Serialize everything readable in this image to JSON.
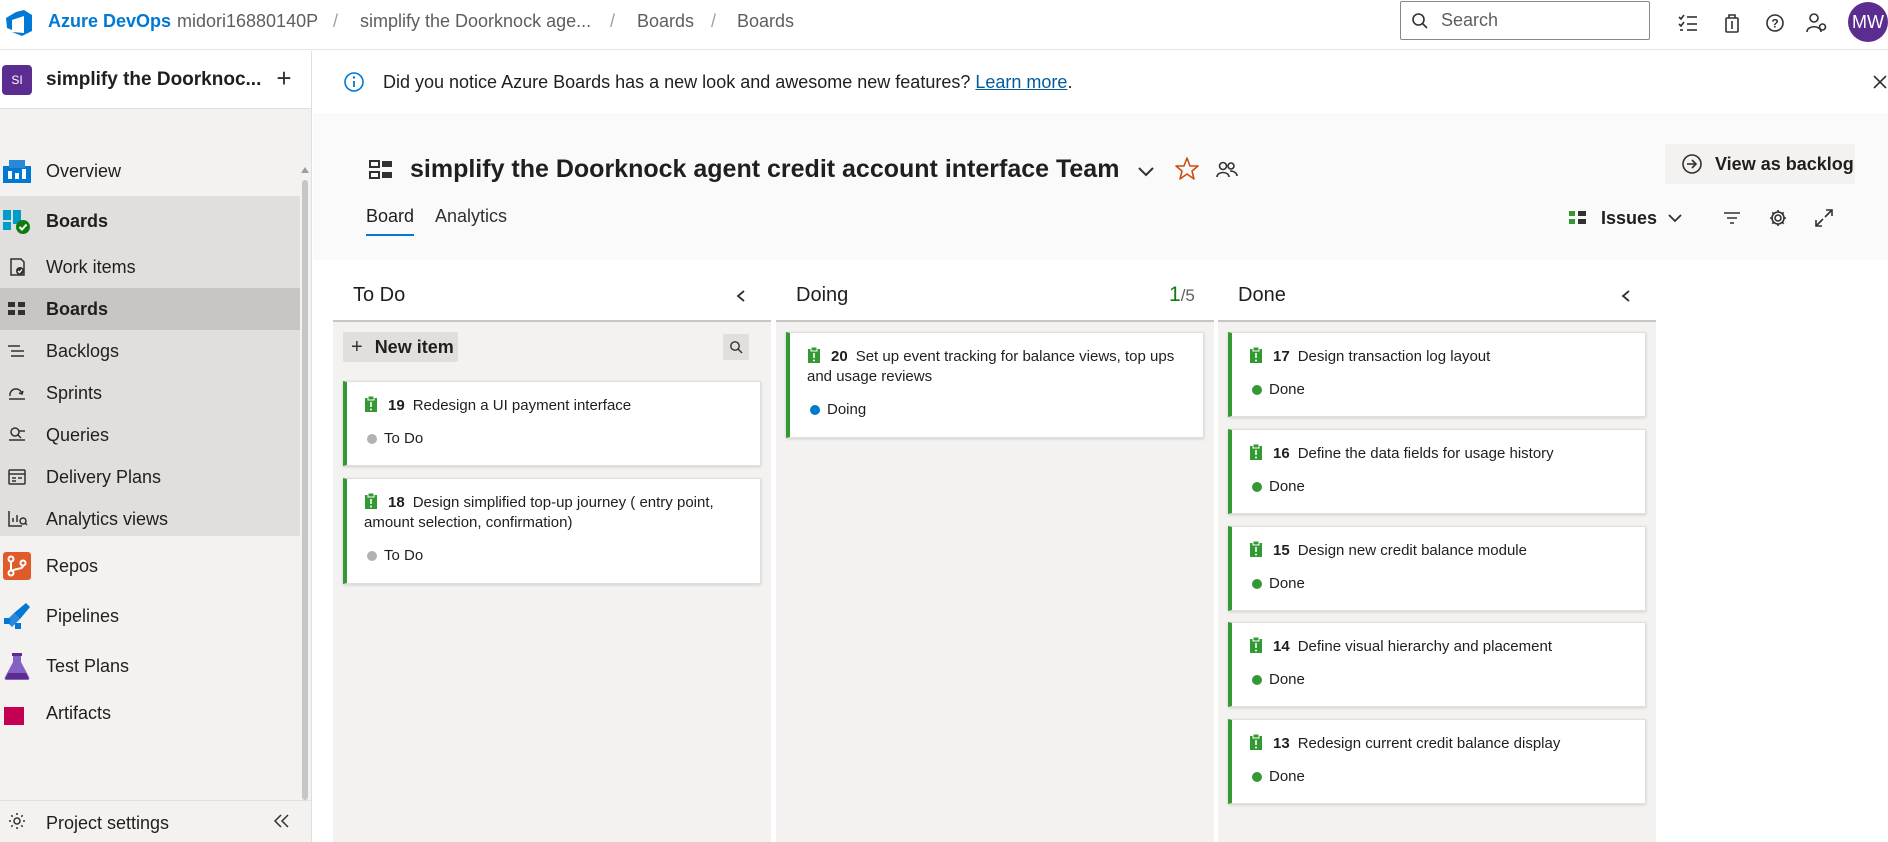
{
  "topbar": {
    "brand": "Azure DevOps",
    "breadcrumbs": [
      "midori16880140P",
      "simplify the Doorknock age...",
      "Boards",
      "Boards"
    ],
    "search_placeholder": "Search",
    "avatar_initials": "MW"
  },
  "sidebar": {
    "project_badge": "SI",
    "project_name": "simplify the Doorknoc...",
    "items": [
      {
        "label": "Overview",
        "icon": "overview-icon"
      },
      {
        "label": "Boards",
        "icon": "boards-hub-icon"
      },
      {
        "label": "Work items",
        "icon": "work-items-icon"
      },
      {
        "label": "Boards",
        "icon": "boards-icon"
      },
      {
        "label": "Backlogs",
        "icon": "backlogs-icon"
      },
      {
        "label": "Sprints",
        "icon": "sprints-icon"
      },
      {
        "label": "Queries",
        "icon": "queries-icon"
      },
      {
        "label": "Delivery Plans",
        "icon": "delivery-plans-icon"
      },
      {
        "label": "Analytics views",
        "icon": "analytics-views-icon"
      },
      {
        "label": "Repos",
        "icon": "repos-icon"
      },
      {
        "label": "Pipelines",
        "icon": "pipelines-icon"
      },
      {
        "label": "Test Plans",
        "icon": "test-plans-icon"
      },
      {
        "label": "Artifacts",
        "icon": "artifacts-icon"
      }
    ],
    "settings_label": "Project settings"
  },
  "banner": {
    "text": "Did you notice Azure Boards has a new look and awesome new features?",
    "link": "Learn more",
    "suffix": "."
  },
  "header": {
    "team_title": "simplify the Doorknock agent credit account interface Team",
    "view_backlog_label": "View as backlog",
    "tabs": [
      "Board",
      "Analytics"
    ],
    "active_tab": "Board",
    "issues_label": "Issues"
  },
  "board": {
    "columns": [
      {
        "title": "To Do",
        "new_item_label": "New item",
        "cards": [
          {
            "id": "19",
            "title": "Redesign a UI payment interface",
            "state": "To Do"
          },
          {
            "id": "18",
            "title": "Design simplified top-up journey ( entry point, amount selection, confirmation)",
            "state": "To Do"
          }
        ]
      },
      {
        "title": "Doing",
        "wip_current": "1",
        "wip_limit": "/5",
        "cards": [
          {
            "id": "20",
            "title": "Set up event tracking for balance views, top ups and usage reviews",
            "state": "Doing"
          }
        ]
      },
      {
        "title": "Done",
        "cards": [
          {
            "id": "17",
            "title": "Design transaction log layout",
            "state": "Done"
          },
          {
            "id": "16",
            "title": "Define the data fields for usage history",
            "state": "Done"
          },
          {
            "id": "15",
            "title": "Design new credit balance module",
            "state": "Done"
          },
          {
            "id": "14",
            "title": "Define visual hierarchy and placement",
            "state": "Done"
          },
          {
            "id": "13",
            "title": "Redesign current credit balance display",
            "state": "Done"
          }
        ]
      }
    ]
  },
  "colors": {
    "accent": "#0078d4",
    "card_bar": "#339933",
    "todo_dot": "#b2b2b2",
    "doing_dot": "#007acc",
    "done_dot": "#339933",
    "project_badge": "#5c2d91"
  }
}
